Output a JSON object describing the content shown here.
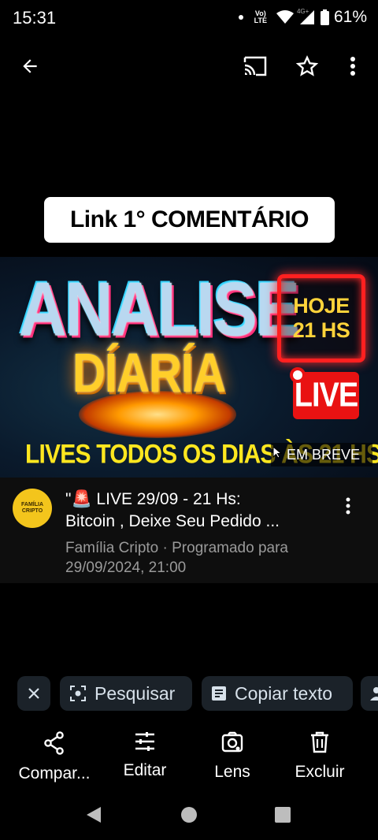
{
  "status_bar": {
    "time": "15:31",
    "network_label_top": "Vo)",
    "network_label_bottom": "LTE",
    "mobile_label": "4G+",
    "battery": "61%"
  },
  "top_bar": {
    "back_icon": "arrow-back-icon",
    "cast_icon": "cast-icon",
    "star_icon": "star-outline-icon",
    "more_icon": "more-vert-icon"
  },
  "caption": "Link 1° COMENTÁRIO",
  "thumbnail": {
    "title_line1": "ANALISE",
    "title_line2": "DÍARÍA",
    "schedule_line1": "HOJE",
    "schedule_line2": "21 HS",
    "live_badge": "LIVE",
    "bottom_text": "LIVES TODOS OS DIAS ÀS 21 HS",
    "status_overlay": "EM BREVE"
  },
  "video": {
    "channel_avatar_text": "FAMÍLIA CRIPTO",
    "title_line1": "\"🚨 LIVE  29/09 - 21  Hs:",
    "title_line2": "Bitcoin ,  Deixe Seu Pedido ...",
    "meta_line1": "Família Cripto · Programado para",
    "meta_line2": "29/09/2024, 21:00"
  },
  "chips": {
    "close_icon": "close-icon",
    "search_label": "Pesquisar",
    "copy_label": "Copiar texto"
  },
  "actions": {
    "share": "Compar...",
    "edit": "Editar",
    "lens": "Lens",
    "delete": "Excluir"
  },
  "colors": {
    "background": "#000000",
    "chip_background": "#1b2229",
    "thumb_yellow": "#ffe71f",
    "live_red": "#e91212"
  }
}
